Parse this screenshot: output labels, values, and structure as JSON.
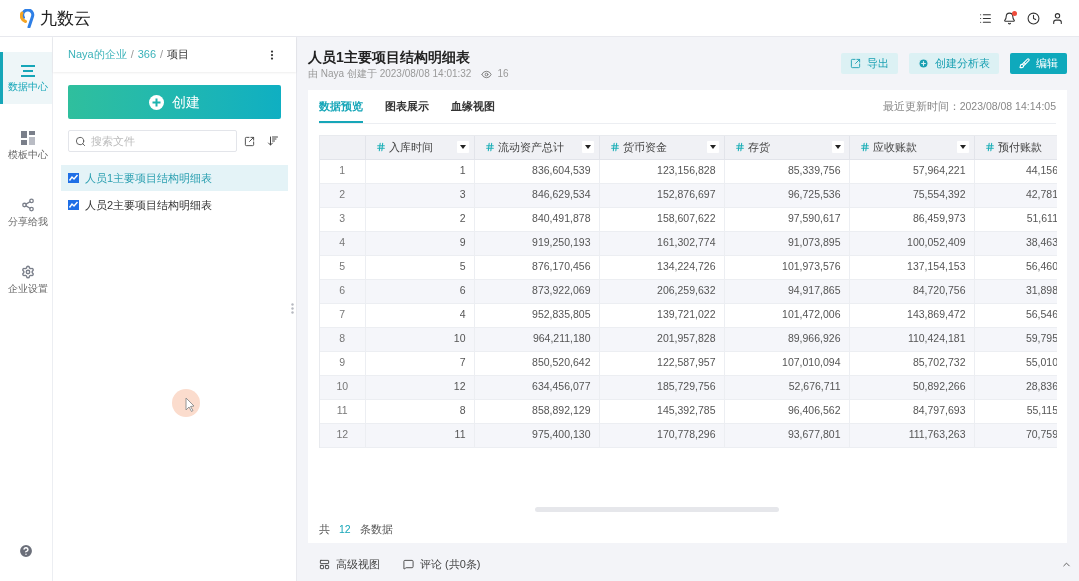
{
  "top_bar": {
    "logo": "九数云",
    "alert": true
  },
  "nav": {
    "items": [
      {
        "label": "数据中心",
        "kind": "data",
        "selected": true
      },
      {
        "label": "模板中心",
        "kind": "template",
        "selected": false
      },
      {
        "label": "分享给我",
        "kind": "share",
        "selected": false
      },
      {
        "label": "企业设置",
        "kind": "settings",
        "selected": false
      }
    ]
  },
  "file_panel": {
    "breadcrumb": [
      {
        "label": "Naya的企业",
        "kind": "link"
      },
      {
        "label": "/",
        "kind": "separator"
      },
      {
        "label": "366",
        "kind": "link"
      },
      {
        "label": "/",
        "kind": "separator"
      },
      {
        "label": "项目",
        "kind": "current"
      }
    ],
    "create_button": "创建",
    "search": {
      "placeholder": "搜索文件"
    },
    "files": [
      {
        "name": "人员1主要项目结构明细表",
        "selected": true
      },
      {
        "name": "人员2主要项目结构明细表",
        "selected": false
      }
    ]
  },
  "report": {
    "title": "人员1主要项目结构明细表",
    "meta": "由 Naya 创建于 2023/08/08 14:01:32",
    "views": "16",
    "actions": [
      {
        "label": "导出",
        "kind": "export"
      },
      {
        "label": "创建分析表",
        "kind": "create"
      },
      {
        "label": "编辑",
        "kind": "edit"
      }
    ]
  },
  "tabs": [
    {
      "label": "数据预览",
      "selected": true
    },
    {
      "label": "图表展示",
      "selected": false
    },
    {
      "label": "血缘视图",
      "selected": false
    }
  ],
  "updated": "最近更新时间：2023/08/08 14:14:05",
  "table": {
    "columns": [
      {
        "label": "入库时间",
        "menu": true
      },
      {
        "label": "流动资产总计",
        "menu": true
      },
      {
        "label": "货币资金",
        "menu": true
      },
      {
        "label": "存货",
        "menu": true
      },
      {
        "label": "应收账款",
        "menu": true
      },
      {
        "label": "预付账款",
        "menu": false
      }
    ],
    "rows": [
      {
        "index": "1",
        "cells": [
          "1",
          "836,604,539",
          "123,156,828",
          "85,339,756",
          "57,964,221",
          "44,156"
        ]
      },
      {
        "index": "2",
        "cells": [
          "3",
          "846,629,534",
          "152,876,697",
          "96,725,536",
          "75,554,392",
          "42,781"
        ]
      },
      {
        "index": "3",
        "cells": [
          "2",
          "840,491,878",
          "158,607,622",
          "97,590,617",
          "86,459,973",
          "51,611"
        ]
      },
      {
        "index": "4",
        "cells": [
          "9",
          "919,250,193",
          "161,302,774",
          "91,073,895",
          "100,052,409",
          "38,463"
        ]
      },
      {
        "index": "5",
        "cells": [
          "5",
          "876,170,456",
          "134,224,726",
          "101,973,576",
          "137,154,153",
          "56,460"
        ]
      },
      {
        "index": "6",
        "cells": [
          "6",
          "873,922,069",
          "206,259,632",
          "94,917,865",
          "84,720,756",
          "31,898"
        ]
      },
      {
        "index": "7",
        "cells": [
          "4",
          "952,835,805",
          "139,721,022",
          "101,472,006",
          "143,869,472",
          "56,546"
        ]
      },
      {
        "index": "8",
        "cells": [
          "10",
          "964,211,180",
          "201,957,828",
          "89,966,926",
          "110,424,181",
          "59,795"
        ]
      },
      {
        "index": "9",
        "cells": [
          "7",
          "850,520,642",
          "122,587,957",
          "107,010,094",
          "85,702,732",
          "55,010"
        ]
      },
      {
        "index": "10",
        "cells": [
          "12",
          "634,456,077",
          "185,729,756",
          "52,676,711",
          "50,892,266",
          "28,836"
        ]
      },
      {
        "index": "11",
        "cells": [
          "8",
          "858,892,129",
          "145,392,785",
          "96,406,562",
          "84,797,693",
          "55,115"
        ]
      },
      {
        "index": "12",
        "cells": [
          "11",
          "975,400,130",
          "170,778,296",
          "93,677,801",
          "111,763,263",
          "70,759"
        ]
      }
    ]
  },
  "footer": {
    "prefix": "共",
    "count": "12",
    "suffix": "条数据"
  },
  "bottom_bar": {
    "items": [
      {
        "label": "高级视图",
        "kind": "view"
      },
      {
        "label": "评论 (共0条)",
        "kind": "comment"
      }
    ]
  }
}
